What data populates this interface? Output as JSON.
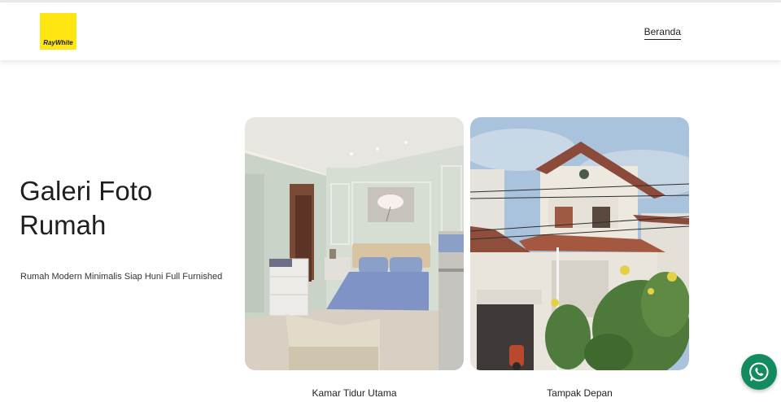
{
  "header": {
    "logo_text": "RayWhite",
    "nav": {
      "home_label": "Beranda"
    }
  },
  "main": {
    "title": "Galeri Foto Rumah",
    "subtitle": "Rumah Modern Minimalis Siap Huni Full Furnished",
    "gallery": [
      {
        "caption": "Kamar Tidur Utama",
        "image": "bedroom-photo"
      },
      {
        "caption": "Tampak Depan",
        "image": "house-front-photo"
      }
    ]
  },
  "floating": {
    "icon": "whatsapp-icon"
  },
  "colors": {
    "brand_yellow": "#ffe512",
    "whatsapp_green": "#128c5e",
    "text": "#222222"
  }
}
